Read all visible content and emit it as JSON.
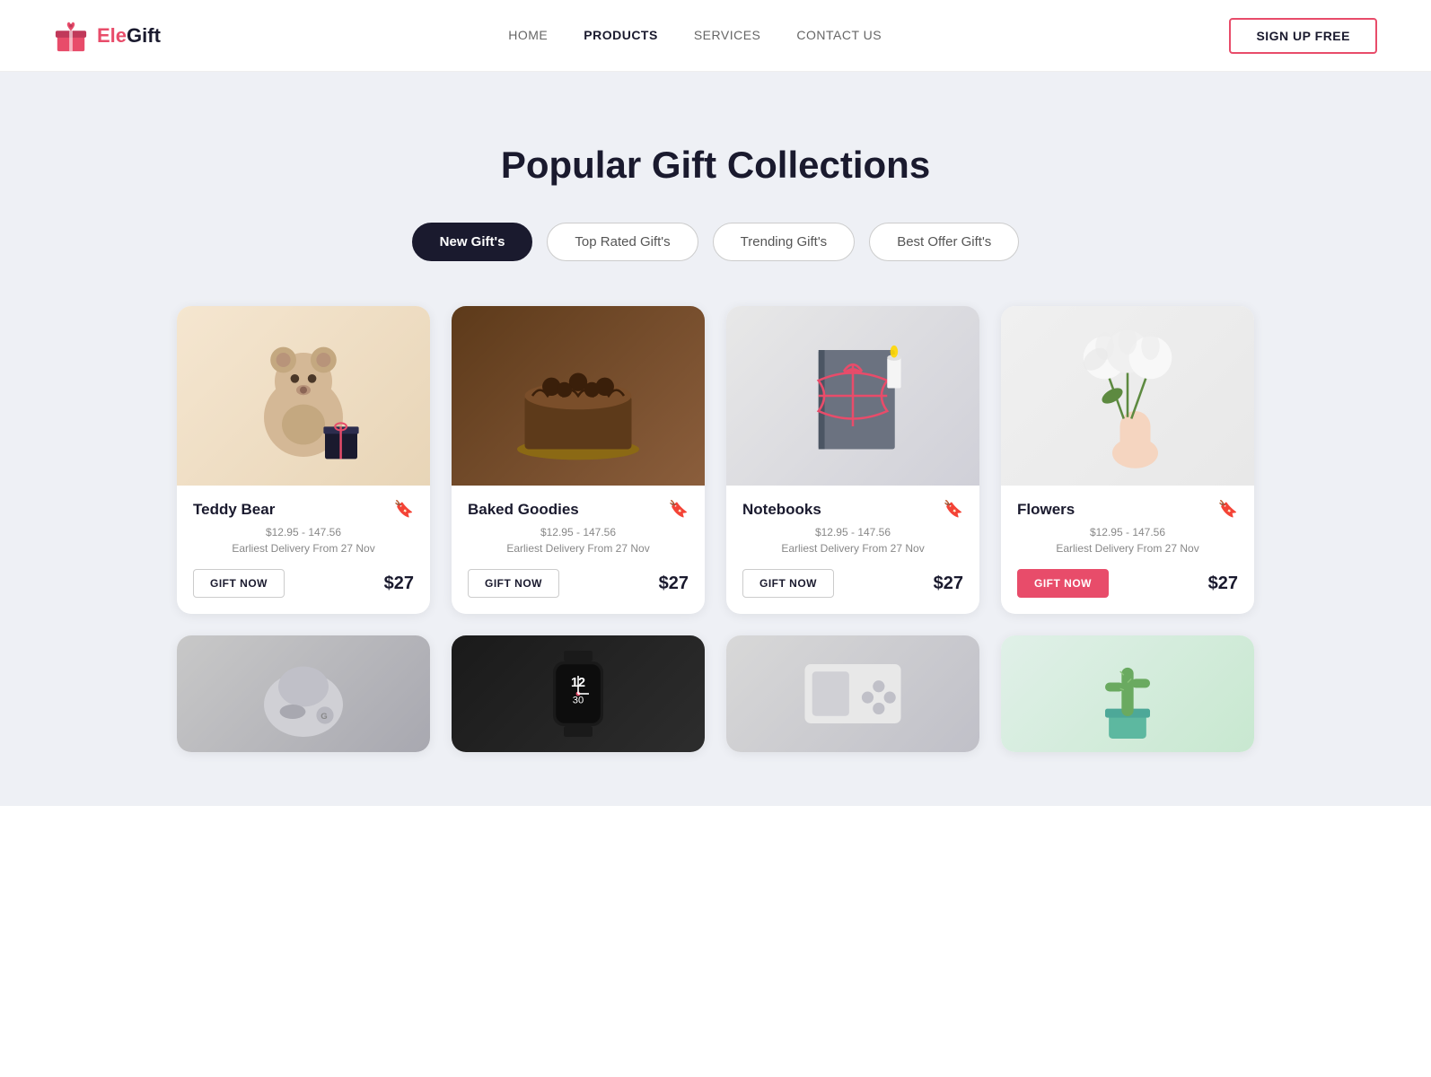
{
  "brand": {
    "name_part1": "Ele",
    "name_part2": "Gift"
  },
  "navbar": {
    "links": [
      {
        "label": "HOME",
        "active": false
      },
      {
        "label": "PRODUCTS",
        "active": true
      },
      {
        "label": "SERVICES",
        "active": false
      },
      {
        "label": "CONTACT US",
        "active": false
      }
    ],
    "signup_label": "SIGN UP FREE"
  },
  "hero": {
    "title": "Popular Gift Collections"
  },
  "filter_tabs": [
    {
      "label": "New Gift's",
      "active": true
    },
    {
      "label": "Top Rated Gift's",
      "active": false
    },
    {
      "label": "Trending Gift's",
      "active": false
    },
    {
      "label": "Best Offer Gift's",
      "active": false
    }
  ],
  "products": [
    {
      "name": "Teddy Bear",
      "price_range": "$12.95 - 147.56",
      "delivery": "Earliest Delivery From 27 Nov",
      "price": "$27",
      "emoji": "🧸",
      "img_class": "img-teddy",
      "btn_active": false
    },
    {
      "name": "Baked Goodies",
      "price_range": "$12.95 - 147.56",
      "delivery": "Earliest Delivery From 27 Nov",
      "price": "$27",
      "emoji": "🎂",
      "img_class": "img-cake",
      "btn_active": false
    },
    {
      "name": "Notebooks",
      "price_range": "$12.95 - 147.56",
      "delivery": "Earliest Delivery From 27 Nov",
      "price": "$27",
      "emoji": "📓",
      "img_class": "img-notebooks",
      "btn_active": false
    },
    {
      "name": "Flowers",
      "price_range": "$12.95 - 147.56",
      "delivery": "Earliest Delivery From 27 Nov",
      "price": "$27",
      "emoji": "💐",
      "img_class": "img-flowers",
      "btn_active": true
    }
  ],
  "second_row": [
    {
      "emoji": "🖱️",
      "img_class": "img-mouse"
    },
    {
      "emoji": "⌚",
      "img_class": "img-watch"
    },
    {
      "emoji": "🎮",
      "img_class": "img-console"
    },
    {
      "emoji": "🌵",
      "img_class": "img-plant"
    }
  ],
  "gift_now_label": "GIFT NOW"
}
